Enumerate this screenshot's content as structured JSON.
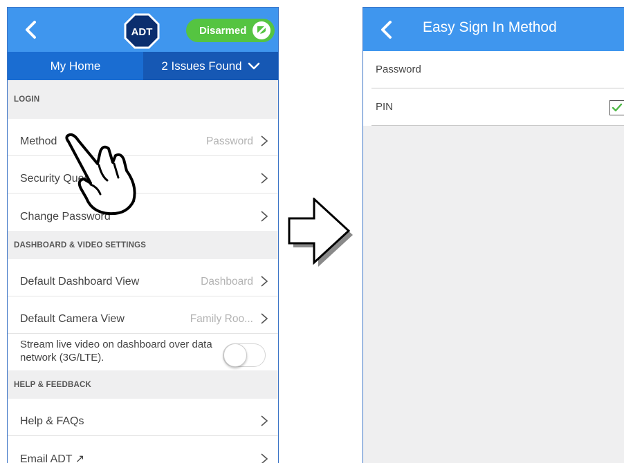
{
  "left": {
    "header": {
      "logo_text": "ADT",
      "status_label": "Disarmed",
      "status_color": "#55c441",
      "brand_color": "#3f96ee"
    },
    "subheader": {
      "home_tab": "My Home",
      "issues_tab": "2 Issues Found"
    },
    "sections": {
      "login": {
        "title": "LOGIN",
        "rows": [
          {
            "label": "Method",
            "value": "Password"
          },
          {
            "label": "Security Questions",
            "value": ""
          },
          {
            "label": "Change Password",
            "value": ""
          }
        ]
      },
      "dashboard": {
        "title": "DASHBOARD & VIDEO SETTINGS",
        "rows": [
          {
            "label": "Default Dashboard View",
            "value": "Dashboard"
          },
          {
            "label": "Default Camera View",
            "value": "Family Roo..."
          }
        ],
        "stream_label": "Stream live video on dashboard over data network (3G/LTE).",
        "stream_enabled": false
      },
      "help": {
        "title": "HELP & FEEDBACK",
        "rows": [
          {
            "label": "Help & FAQs",
            "value": ""
          },
          {
            "label": "Email ADT ↗",
            "value": ""
          }
        ]
      }
    }
  },
  "right": {
    "title": "Easy Sign In Method",
    "options": [
      {
        "label": "Password",
        "selected": false
      },
      {
        "label": "PIN",
        "selected": true
      }
    ],
    "check_color": "#4fb947"
  }
}
